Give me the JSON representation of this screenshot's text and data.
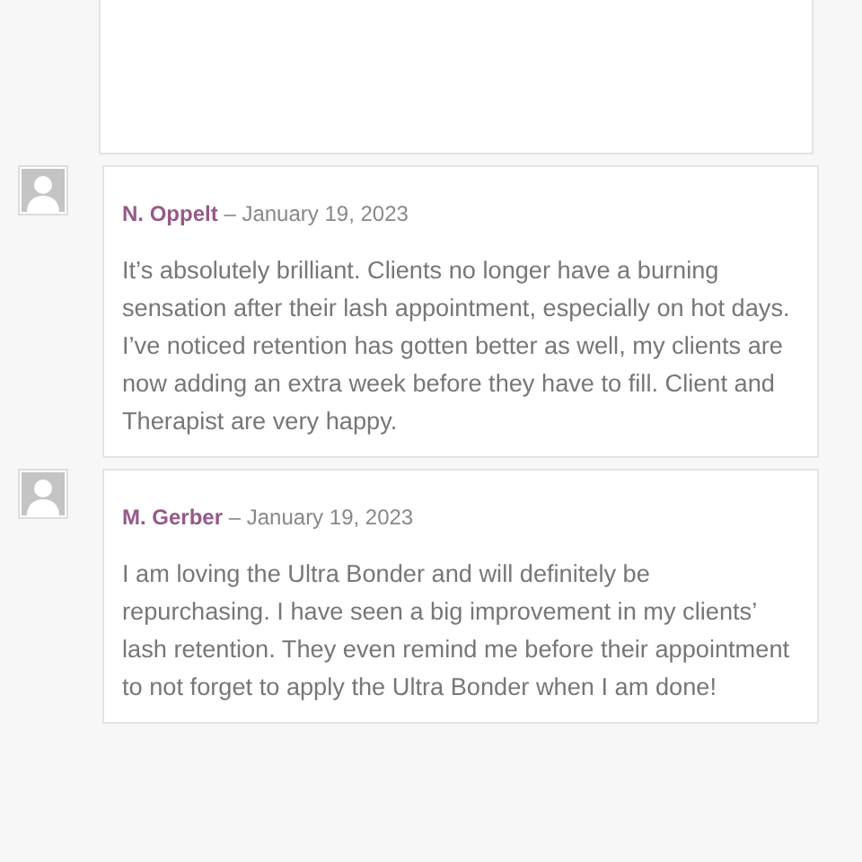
{
  "comments": [
    {
      "author": "N. Oppelt",
      "date": "– January 19, 2023",
      "text": "It’s absolutely brilliant. Clients no longer have a burning sensation after their lash appointment, especially on hot days. I’ve noticed retention has gotten better as well, my clients are now adding an extra week before they have to fill. Client and Therapist are very happy."
    },
    {
      "author": "M. Gerber",
      "date": "– January 19, 2023",
      "text": "I am loving the Ultra Bonder and will definitely be repurchasing. I have seen a big improvement in my clients’ lash retention. They even remind me before their appointment to not forget to apply the Ultra Bonder when I am done!"
    }
  ]
}
